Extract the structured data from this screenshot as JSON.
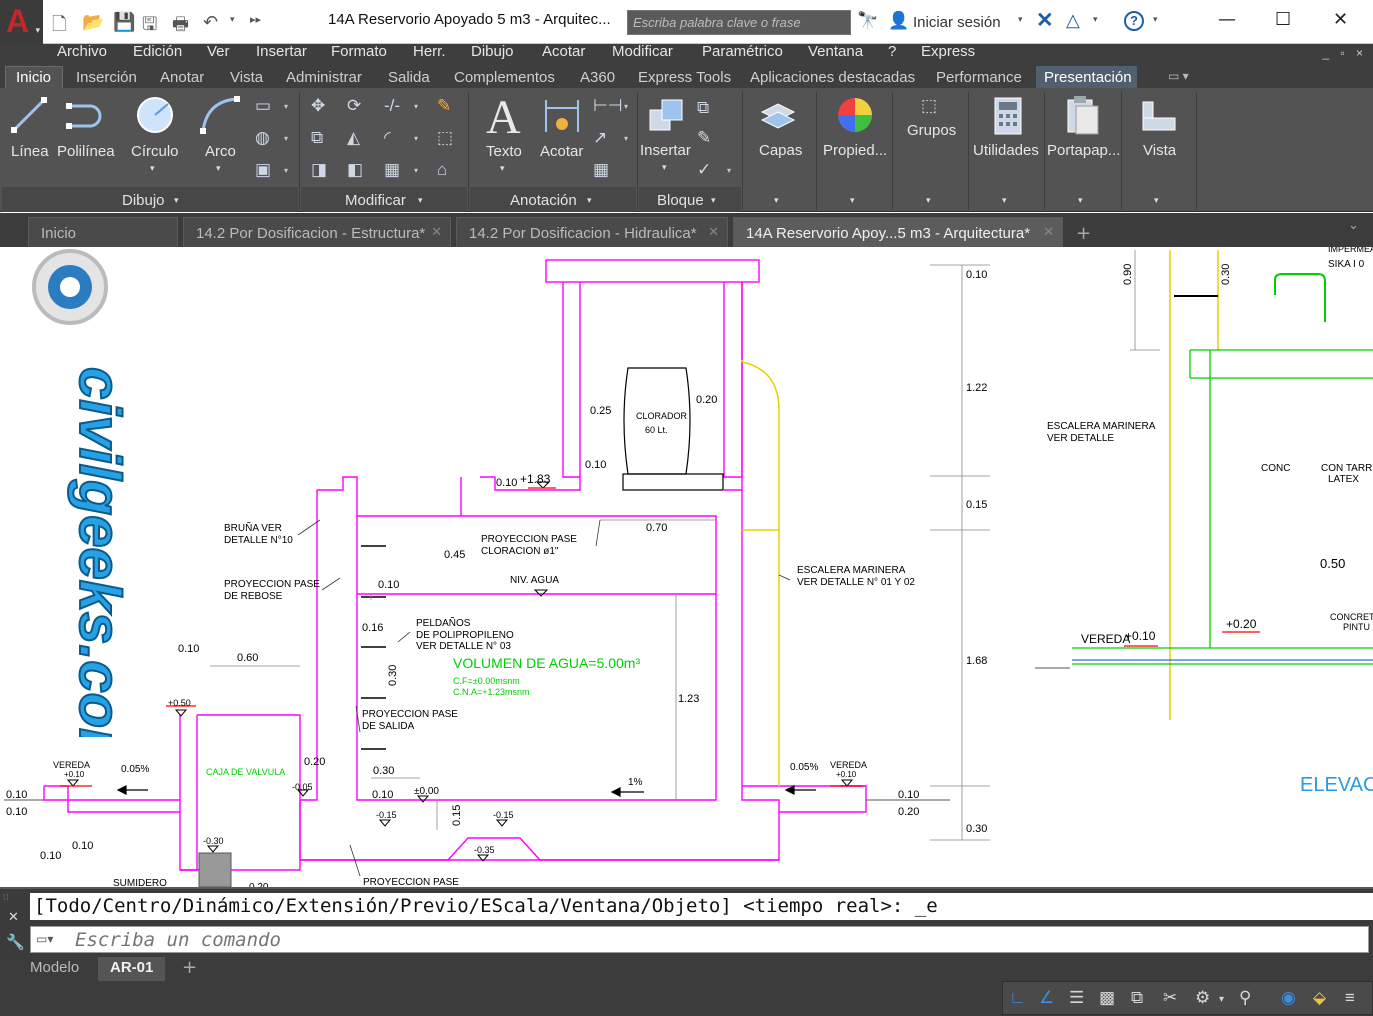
{
  "app": {
    "logo_letter": "A",
    "window_title": "14A Reservorio Apoyado 5 m3 - Arquitec...",
    "search_placeholder": "Escriba palabra clave o frase",
    "signin_label": "Iniciar sesión",
    "help_label": "?"
  },
  "menubar": {
    "items": [
      "Archivo",
      "Edición",
      "Ver",
      "Insertar",
      "Formato",
      "Herr.",
      "Dibujo",
      "Acotar",
      "Modificar",
      "Paramétrico",
      "Ventana",
      "?",
      "Express"
    ]
  },
  "ribbon_tabs": {
    "items": [
      "Inicio",
      "Inserción",
      "Anotar",
      "Vista",
      "Administrar",
      "Salida",
      "Complementos",
      "A360",
      "Express Tools",
      "Aplicaciones destacadas",
      "Performance",
      "Presentación"
    ],
    "active": "Inicio"
  },
  "ribbon": {
    "draw": {
      "title": "Dibujo",
      "line": "Línea",
      "polyline": "Polilínea",
      "circle": "Círculo",
      "arc": "Arco"
    },
    "modify": {
      "title": "Modificar"
    },
    "annotation": {
      "title": "Anotación",
      "text": "Texto",
      "dimension": "Acotar"
    },
    "block": {
      "title": "Bloque",
      "insert": "Insertar"
    },
    "layers": "Capas",
    "properties": "Propied...",
    "groups": "Grupos",
    "utilities": "Utilidades",
    "clipboard": "Portapap...",
    "view": "Vista"
  },
  "doc_tabs": [
    {
      "label": "Inicio"
    },
    {
      "label": "14.2 Por Dosificacion - Estructura*"
    },
    {
      "label": "14.2 Por Dosificacion - Hidraulica*"
    },
    {
      "label": "14A Reservorio Apoy...5 m3 - Arquitectura*"
    }
  ],
  "drawing": {
    "labels": {
      "dim_010_top": "0.10",
      "dim_122": "1.22",
      "dim_015": "0.15",
      "dim_168": "1.68",
      "dim_030": "0.30",
      "dim_025": "0.25",
      "dim_020a": "0.20",
      "dim_010b": "0.10",
      "dim_plus183": "+1.83",
      "dim_010c": "0.10",
      "dim_070": "0.70",
      "dim_045": "0.45",
      "dim_010d": "0.10",
      "dim_016": "0.16",
      "dim_030b": "0.30",
      "dim_123": "1.23",
      "dim_010e": "0.10",
      "dim_060": "0.60",
      "dim_020b": "0.20",
      "dim_030c": "0.30",
      "dim_010f": "0.10",
      "dim_pm000": "±0.00",
      "dim_m015a": "-0.15",
      "dim_m015b": "-0.15",
      "dim_015b": "0.15",
      "dim_m035": "-0.35",
      "dim_m030": "-0.30",
      "dim_plus050": "+0.50",
      "dim_m005": "-0.05",
      "dim_010g": "0.10",
      "dim_010h": "0.10",
      "dim_010i": "0.10",
      "dim_010j": "0.10",
      "dim_010k": "0.10",
      "dim_020c": "0.20",
      "dim_090": "0.90",
      "dim_030d": "0.30",
      "dim_050r": "0.50",
      "clorador": "CLORADOR",
      "clorador_vol": "60 Lt.",
      "bruna": "BRUÑA VER",
      "bruna2": "DETALLE N°10",
      "proy_rebose": "PROYECCION PASE",
      "proy_rebose2": "DE REBOSE",
      "proy_cloracion": "PROYECCION PASE",
      "proy_cloracion2": "CLORACION ø1\"",
      "niv_agua": "NIV. AGUA",
      "peldanos": "PELDAÑOS",
      "peldanos2": "DE POLIPROPILENO",
      "peldanos3": "VER DETALLE N° 03",
      "volumen": "VOLUMEN DE AGUA=5.00m³",
      "cf": "C.F=±0.00msnm",
      "cna": "C.N.A=+1.23msnm",
      "proy_salida": "PROYECCION PASE",
      "proy_salida2": "DE SALIDA",
      "caja_valvula": "CAJA DE VALVULA",
      "vereda_l": "VEREDA",
      "vereda_l_lvl": "+0.10",
      "slope_l": "0.05%",
      "slope_1": "1%",
      "slope_r": "0.05%",
      "vereda_r": "VEREDA",
      "vereda_r_lvl": "+0.10",
      "escalera": "ESCALERA MARINERA",
      "escalera2": "VER DETALLE N° 01 Y 02",
      "sumidero": "SUMIDERO",
      "proy_bottom": "PROYECCION PASE",
      "dim_020_bottom": "0.20",
      "escalera_r": "ESCALERA MARINERA",
      "escalera_r2": "VER DETALLE",
      "con_tarr": "CON TARR",
      "latex": "LATEX",
      "cond": "CONC",
      "sika": "SIKA I 0",
      "imperm": "IMPERMEA",
      "vereda_far": "VEREDA",
      "vereda_far_lvl": "+0.10",
      "lvl_020": "+0.20",
      "concreto": "CONCRETO",
      "pintu": "PINTU",
      "elevac": "ELEVAC"
    },
    "watermark": "civilgeeks.com"
  },
  "command": {
    "history": "[Todo/Centro/Dinámico/Extensión/Previo/EScala/Ventana/Objeto] <tiempo real>: _e",
    "placeholder": "Escriba un comando"
  },
  "layout_tabs": {
    "items": [
      "Modelo",
      "AR-01"
    ],
    "active": "AR-01"
  },
  "colors": {
    "magenta": "#ff00ff",
    "red": "#ff0000",
    "green": "#00d000",
    "yellow": "#e8e800",
    "accent_blue": "#3a8fe0"
  }
}
